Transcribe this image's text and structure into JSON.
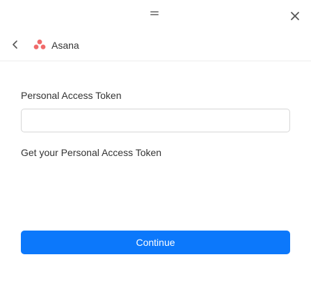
{
  "window": {
    "grip_icon": "grip-lines-icon",
    "close_icon": "close-icon"
  },
  "header": {
    "back_icon": "chevron-left-icon",
    "app_logo_icon": "asana-logo-icon",
    "app_name": "Asana"
  },
  "form": {
    "token_label": "Personal Access Token",
    "token_value": "",
    "get_token_link": "Get your Personal Access Token",
    "continue_label": "Continue"
  },
  "colors": {
    "accent": "#0c78fb",
    "asana_coral": "#f06a6a",
    "text": "#333333",
    "border": "#d6d6d6"
  }
}
